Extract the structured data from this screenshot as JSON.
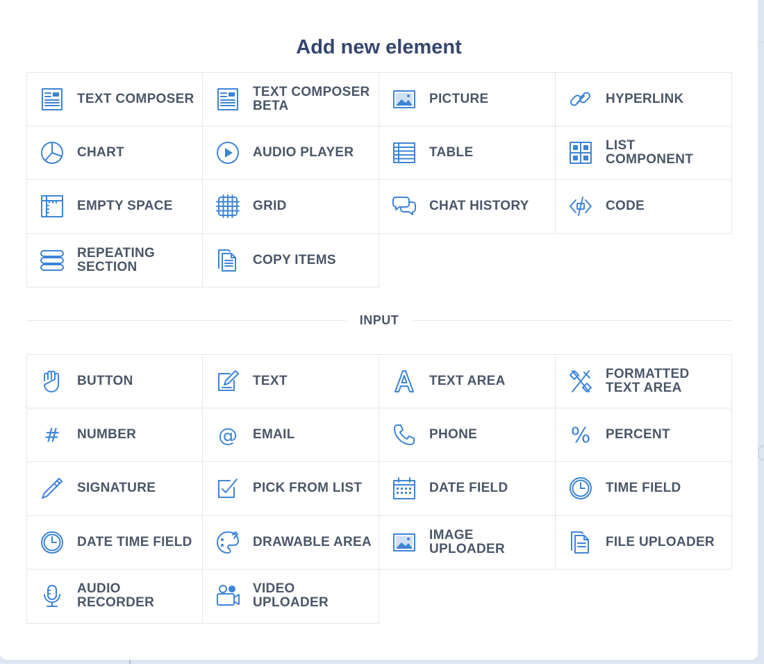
{
  "modal": {
    "title": "Add new element"
  },
  "colors": {
    "accent": "#3d84d6",
    "label_text": "#4a5668",
    "title_text": "#34456e",
    "border": "#e3e7ec"
  },
  "layout_elements": [
    {
      "label": "TEXT COMPOSER",
      "icon": "text-composer-icon"
    },
    {
      "label": "TEXT COMPOSER\nBETA",
      "icon": "text-composer-icon"
    },
    {
      "label": "PICTURE",
      "icon": "picture-icon"
    },
    {
      "label": "HYPERLINK",
      "icon": "hyperlink-icon"
    },
    {
      "label": "CHART",
      "icon": "chart-icon"
    },
    {
      "label": "AUDIO PLAYER",
      "icon": "audio-player-icon"
    },
    {
      "label": "TABLE",
      "icon": "table-icon"
    },
    {
      "label": "LIST\nCOMPONENT",
      "icon": "list-component-icon"
    },
    {
      "label": "EMPTY SPACE",
      "icon": "empty-space-icon"
    },
    {
      "label": "GRID",
      "icon": "grid-icon"
    },
    {
      "label": "CHAT HISTORY",
      "icon": "chat-history-icon"
    },
    {
      "label": "CODE",
      "icon": "code-icon"
    },
    {
      "label": "REPEATING\nSECTION",
      "icon": "repeating-section-icon"
    },
    {
      "label": "COPY ITEMS",
      "icon": "copy-items-icon"
    }
  ],
  "input_section": {
    "label": "INPUT"
  },
  "input_elements": [
    {
      "label": "BUTTON",
      "icon": "hand-icon"
    },
    {
      "label": "TEXT",
      "icon": "edit-text-icon"
    },
    {
      "label": "TEXT AREA",
      "icon": "text-area-icon"
    },
    {
      "label": "FORMATTED\nTEXT AREA",
      "icon": "formatted-text-icon"
    },
    {
      "label": "NUMBER",
      "icon": "hash-icon"
    },
    {
      "label": "EMAIL",
      "icon": "at-icon"
    },
    {
      "label": "PHONE",
      "icon": "phone-icon"
    },
    {
      "label": "PERCENT",
      "icon": "percent-icon"
    },
    {
      "label": "SIGNATURE",
      "icon": "pen-icon"
    },
    {
      "label": "PICK FROM LIST",
      "icon": "checkbox-edit-icon"
    },
    {
      "label": "DATE FIELD",
      "icon": "calendar-icon"
    },
    {
      "label": "TIME FIELD",
      "icon": "clock-icon"
    },
    {
      "label": "DATE TIME FIELD",
      "icon": "clock-icon"
    },
    {
      "label": "DRAWABLE AREA",
      "icon": "palette-icon"
    },
    {
      "label": "IMAGE\nUPLOADER",
      "icon": "picture-icon"
    },
    {
      "label": "FILE UPLOADER",
      "icon": "file-icon"
    },
    {
      "label": "AUDIO\nRECORDER",
      "icon": "microphone-icon"
    },
    {
      "label": "VIDEO\nUPLOADER",
      "icon": "video-camera-icon"
    }
  ]
}
